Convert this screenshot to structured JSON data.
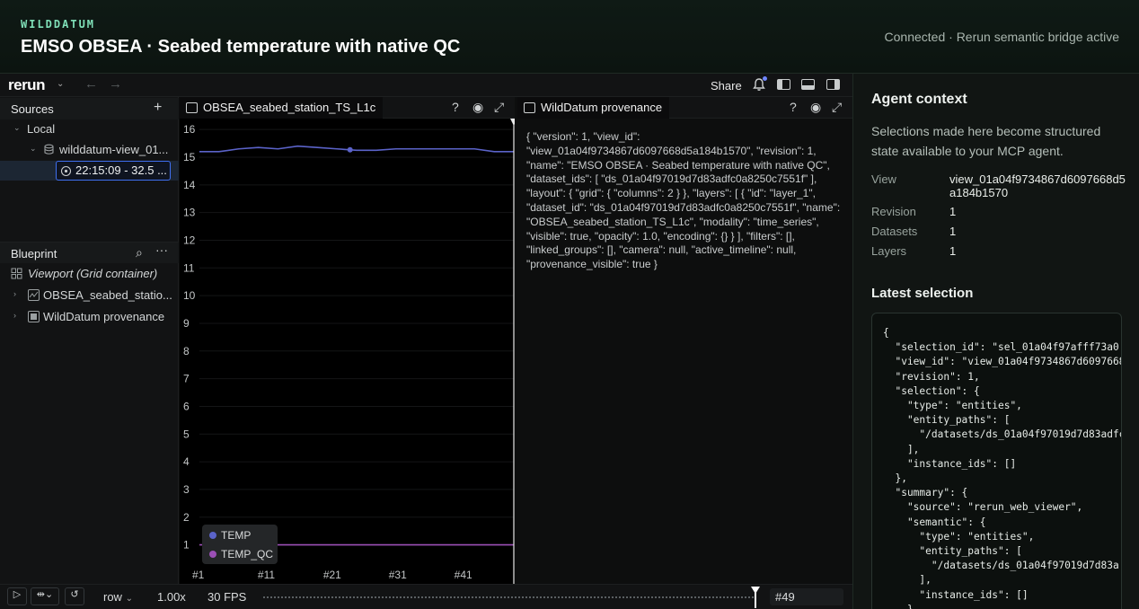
{
  "header": {
    "brand": "WILDDATUM",
    "title": "EMSO OBSEA · Seabed temperature with native QC",
    "status": "Connected · Rerun semantic bridge active"
  },
  "rerun": {
    "logo": "rerun",
    "share_label": "Share",
    "sources": {
      "title": "Sources",
      "local_label": "Local",
      "recording_label": "wilddatum-view_01...",
      "entry_label": "22:15:09 - 32.5 ..."
    },
    "blueprint": {
      "title": "Blueprint",
      "viewport_label": "Viewport (Grid container)",
      "items": [
        "OBSEA_seabed_statio...",
        "WildDatum provenance"
      ]
    },
    "timeseries_view": {
      "tab_label": "OBSEA_seabed_station_TS_L1c",
      "legend": [
        {
          "name": "TEMP",
          "color": "#5b63c9"
        },
        {
          "name": "TEMP_QC",
          "color": "#9b4fb5"
        }
      ]
    },
    "provenance_view": {
      "tab_label": "WildDatum provenance",
      "text": "{ \"version\": 1, \"view_id\": \"view_01a04f9734867d6097668d5a184b1570\", \"revision\": 1, \"name\": \"EMSO OBSEA · Seabed temperature with native QC\", \"dataset_ids\": [ \"ds_01a04f97019d7d83adfc0a8250c7551f\" ], \"layout\": { \"grid\": { \"columns\": 2 } }, \"layers\": [ { \"id\": \"layer_1\", \"dataset_id\": \"ds_01a04f97019d7d83adfc0a8250c7551f\", \"name\": \"OBSEA_seabed_station_TS_L1c\", \"modality\": \"time_series\", \"visible\": true, \"opacity\": 1.0, \"encoding\": {} } ], \"filters\": [], \"linked_groups\": [], \"camera\": null, \"active_timeline\": null, \"provenance_visible\": true }"
    },
    "timeline": {
      "timeline_name": "row",
      "speed": "1.00x",
      "fps": "30 FPS",
      "current_frame": "#49"
    }
  },
  "chart_data": {
    "type": "line",
    "x_tick_labels": [
      "#1",
      "#11",
      "#21",
      "#31",
      "#41"
    ],
    "y_tick_labels": [
      "1",
      "2",
      "3",
      "4",
      "5",
      "6",
      "7",
      "8",
      "9",
      "10",
      "11",
      "12",
      "13",
      "14",
      "15",
      "16"
    ],
    "xlim": [
      1,
      49
    ],
    "ylim": [
      0.5,
      16.2
    ],
    "series": [
      {
        "name": "TEMP",
        "color": "#5b63c9",
        "x": [
          1,
          4,
          7,
          10,
          13,
          16,
          19,
          22,
          25,
          28,
          31,
          34,
          37,
          40,
          43,
          46,
          49
        ],
        "y": [
          15.2,
          15.2,
          15.3,
          15.35,
          15.3,
          15.4,
          15.35,
          15.3,
          15.25,
          15.25,
          15.3,
          15.3,
          15.3,
          15.3,
          15.3,
          15.2,
          15.2
        ],
        "highlight_x": 24
      },
      {
        "name": "TEMP_QC",
        "color": "#9b4fb5",
        "x": [
          1,
          49
        ],
        "y": [
          1,
          1
        ]
      }
    ]
  },
  "agent": {
    "title": "Agent context",
    "description": "Selections made here become structured state available to your MCP agent.",
    "fields": [
      {
        "key": "View",
        "value": "view_01a04f9734867d6097668d5a184b1570"
      },
      {
        "key": "Revision",
        "value": "1"
      },
      {
        "key": "Datasets",
        "value": "1"
      },
      {
        "key": "Layers",
        "value": "1"
      }
    ],
    "latest_title": "Latest selection",
    "latest_json": "{\n  \"selection_id\": \"sel_01a04f97afff73a0\n  \"view_id\": \"view_01a04f9734867d6097668\n  \"revision\": 1,\n  \"selection\": {\n    \"type\": \"entities\",\n    \"entity_paths\": [\n      \"/datasets/ds_01a04f97019d7d83adfc\n    ],\n    \"instance_ids\": []\n  },\n  \"summary\": {\n    \"source\": \"rerun_web_viewer\",\n    \"semantic\": {\n      \"type\": \"entities\",\n      \"entity_paths\": [\n        \"/datasets/ds_01a04f97019d7d83a\n      ],\n      \"instance_ids\": []\n    }"
  }
}
